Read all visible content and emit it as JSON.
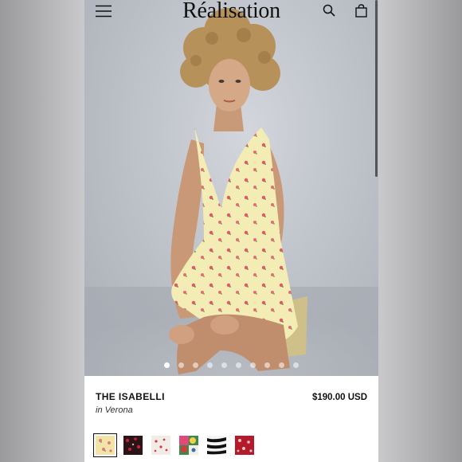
{
  "header": {
    "logo": "Réalisation",
    "menu_icon": "menu-icon",
    "search_icon": "search-icon",
    "bag_icon": "shopping-bag-icon"
  },
  "gallery": {
    "image": "model-wearing-yellow-floral-dress",
    "slide_count": 10,
    "active_index": 0
  },
  "product": {
    "name": "THE ISABELLI",
    "variant": "in Verona",
    "price": "$190.00 USD"
  },
  "swatches": [
    {
      "name": "yellow-floral",
      "color": "#f2e3a6",
      "selected": true
    },
    {
      "name": "black-red-floral",
      "color": "#2a1418",
      "selected": false
    },
    {
      "name": "white-red-floral",
      "color": "#f3ece6",
      "selected": false
    },
    {
      "name": "multicolor-floral",
      "color": "#3f8a4a",
      "selected": false
    },
    {
      "name": "zebra",
      "color": "#1a1a1a",
      "selected": false
    },
    {
      "name": "red-floral",
      "color": "#b51a2a",
      "selected": false
    }
  ],
  "colors": {
    "background": "#ffffff",
    "text": "#111111",
    "dress": "#f3ecb4"
  }
}
